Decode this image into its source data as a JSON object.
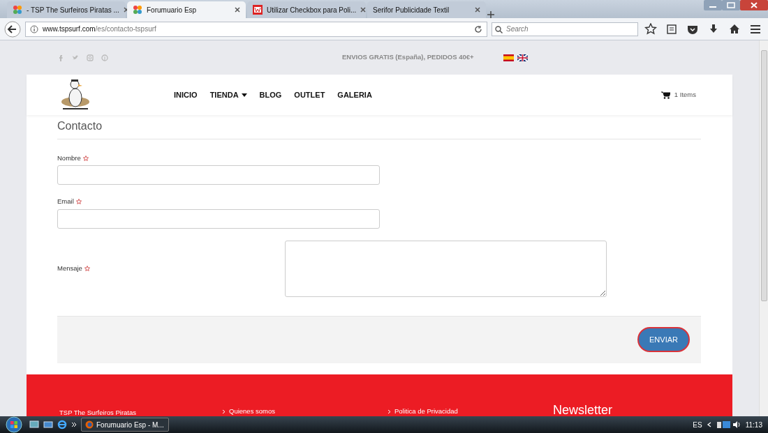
{
  "browser": {
    "tabs": [
      {
        "title": "- TSP The Surfeiros Piratas ...",
        "selected": false
      },
      {
        "title": "Forumuario Esp",
        "selected": true
      },
      {
        "title": "Utilizar Checkbox para Poli...",
        "selected": false
      },
      {
        "title": "Serifor Publicidade Textil",
        "selected": false
      }
    ],
    "url_host": "www.tspsurf.com",
    "url_path": "/es/contacto-tspsurf",
    "search": {
      "placeholder": "Search"
    }
  },
  "topbar": {
    "promo": "ENVIOS GRATIS (España), PEDIDOS 40€+"
  },
  "nav": {
    "items": [
      {
        "label": "INICIO",
        "dropdown": false
      },
      {
        "label": "TIENDA",
        "dropdown": true
      },
      {
        "label": "BLOG",
        "dropdown": false
      },
      {
        "label": "OUTLET",
        "dropdown": false
      },
      {
        "label": "GALERIA",
        "dropdown": false
      }
    ],
    "cart": "1 Items"
  },
  "heading": "Contacto",
  "fields": [
    {
      "label": "Nombre",
      "kind": "input",
      "required": true
    },
    {
      "label": "Email",
      "kind": "input",
      "required": true
    },
    {
      "label": "Mensaje",
      "kind": "textarea",
      "required": true
    }
  ],
  "submit": "ENVIAR",
  "footer": {
    "company": "TSP The Surfeiros Piratas",
    "links": [
      "Quienes somos",
      "Politica de Privacidad"
    ],
    "newsletter": "Newsletter"
  },
  "taskbar": {
    "window": "Forumuario Esp - M...",
    "lang": "ES",
    "time": "11:13"
  }
}
